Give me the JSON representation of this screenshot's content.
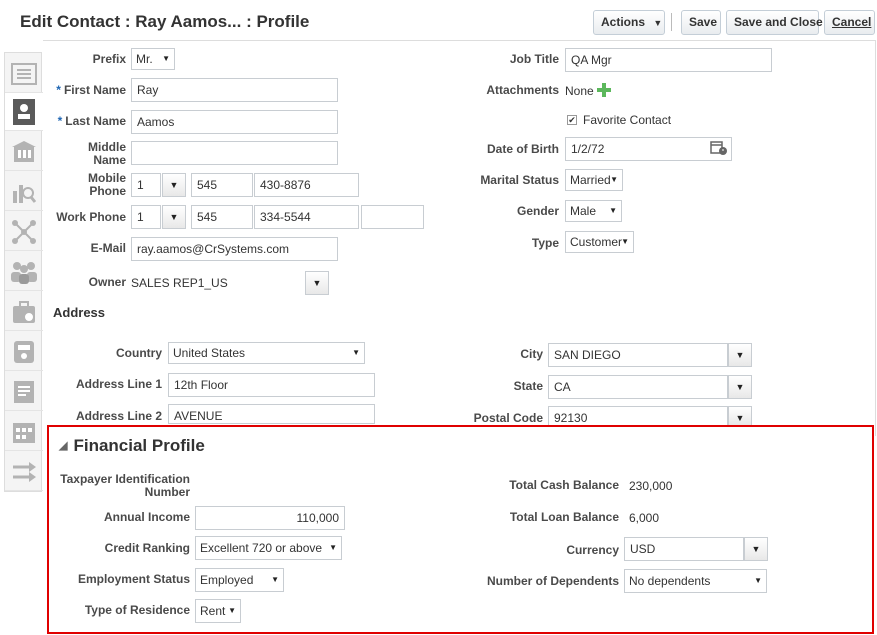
{
  "page": {
    "title": "Edit Contact : Ray Aamos... : Profile"
  },
  "toolbar": {
    "actions_label": "Actions",
    "save_label": "Save",
    "save_close_label": "Save and Close",
    "cancel_label": "Cancel"
  },
  "sidebar": {
    "tabs": [
      "list-icon",
      "contact-card-icon",
      "building-icon",
      "search-chart-icon",
      "network-icon",
      "team-icon",
      "briefcase-icon",
      "calculator-icon",
      "document-icon",
      "calendar-icon",
      "transfer-icon"
    ]
  },
  "contact": {
    "prefix_label": "Prefix",
    "prefix_value": "Mr.",
    "first_name_label": "First Name",
    "first_name_value": "Ray",
    "last_name_label": "Last Name",
    "last_name_value": "Aamos",
    "middle_name_label": "Middle Name",
    "middle_name_value": "",
    "mobile_label": "Mobile Phone",
    "mobile_country": "1",
    "mobile_area": "545",
    "mobile_number": "430-8876",
    "work_label": "Work Phone",
    "work_country": "1",
    "work_area": "545",
    "work_number": "334-5544",
    "work_ext": "",
    "email_label": "E-Mail",
    "email_value": "ray.aamos@CrSystems.com",
    "owner_label": "Owner",
    "owner_value": "SALES REP1_US",
    "job_title_label": "Job Title",
    "job_title_value": "QA Mgr",
    "attachments_label": "Attachments",
    "attachments_value": "None",
    "favorite_label": "Favorite Contact",
    "favorite_checked": true,
    "dob_label": "Date of Birth",
    "dob_value": "1/2/72",
    "marital_label": "Marital Status",
    "marital_value": "Married",
    "gender_label": "Gender",
    "gender_value": "Male",
    "type_label": "Type",
    "type_value": "Customer"
  },
  "address": {
    "section_label": "Address",
    "country_label": "Country",
    "country_value": "United States",
    "line1_label": "Address Line 1",
    "line1_value": "12th Floor",
    "line2_label": "Address Line 2",
    "line2_value": "AVENUE",
    "city_label": "City",
    "city_value": "SAN DIEGO",
    "state_label": "State",
    "state_value": "CA",
    "postal_label": "Postal Code",
    "postal_value": "92130"
  },
  "financial": {
    "section_label": "Financial Profile",
    "tin_label": "Taxpayer Identification Number",
    "annual_income_label": "Annual Income",
    "annual_income_value": "110,000",
    "credit_label": "Credit Ranking",
    "credit_value": "Excellent 720 or above",
    "employment_label": "Employment Status",
    "employment_value": "Employed",
    "residence_label": "Type of Residence",
    "residence_value": "Rent",
    "cash_label": "Total Cash Balance",
    "cash_value": "230,000",
    "loan_label": "Total Loan Balance",
    "loan_value": "6,000",
    "currency_label": "Currency",
    "currency_value": "USD",
    "dependents_label": "Number of Dependents",
    "dependents_value": "No dependents"
  },
  "colors": {
    "highlight": "#e00000",
    "required": "#1f66b3",
    "add_icon": "#5cb85c"
  }
}
